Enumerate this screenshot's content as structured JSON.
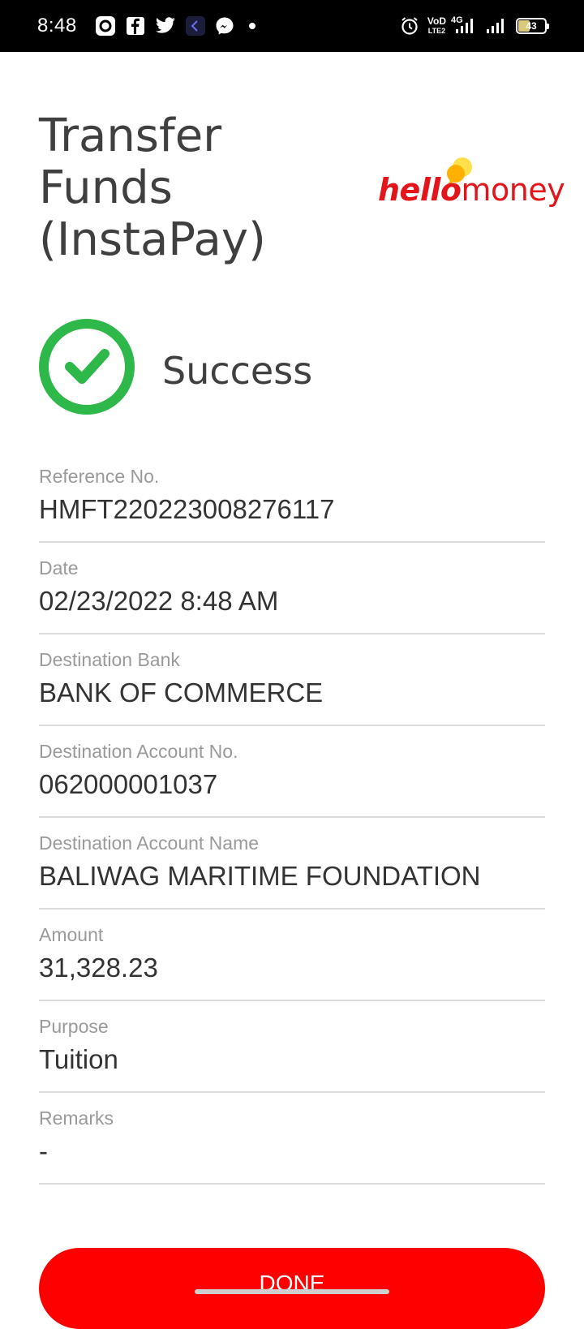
{
  "status_bar": {
    "time": "8:48",
    "battery": "43",
    "network_label": "4G",
    "volte_top": "VoD",
    "volte_bottom": "LTE2",
    "left_icons": [
      "threads-icon",
      "facebook-icon",
      "twitter-icon",
      "app-icon",
      "messenger-icon",
      "dot-icon"
    ],
    "right_icons": [
      "alarm-icon",
      "volte-icon",
      "signal-4g-icon",
      "signal-icon",
      "battery-icon"
    ]
  },
  "header": {
    "title": "Transfer Funds (InstaPay)",
    "logo_hello": "hello",
    "logo_money": "money"
  },
  "success": {
    "label": "Success",
    "icon": "check-circle-icon",
    "color": "#2eb84a"
  },
  "details": [
    {
      "label": "Reference No.",
      "value": "HMFT220223008276117"
    },
    {
      "label": "Date",
      "value": "02/23/2022 8:48 AM"
    },
    {
      "label": "Destination Bank",
      "value": "BANK OF COMMERCE"
    },
    {
      "label": "Destination Account No.",
      "value": "062000001037"
    },
    {
      "label": "Destination Account Name",
      "value": "BALIWAG MARITIME FOUNDATION"
    },
    {
      "label": "Amount",
      "value": "31,328.23"
    },
    {
      "label": "Purpose",
      "value": "Tuition"
    },
    {
      "label": "Remarks",
      "value": "-"
    }
  ],
  "done_button": {
    "label": "DONE",
    "color": "#fe0000"
  },
  "colors": {
    "brand_red": "#e4141b",
    "accent_yellow": "#ffc200"
  }
}
